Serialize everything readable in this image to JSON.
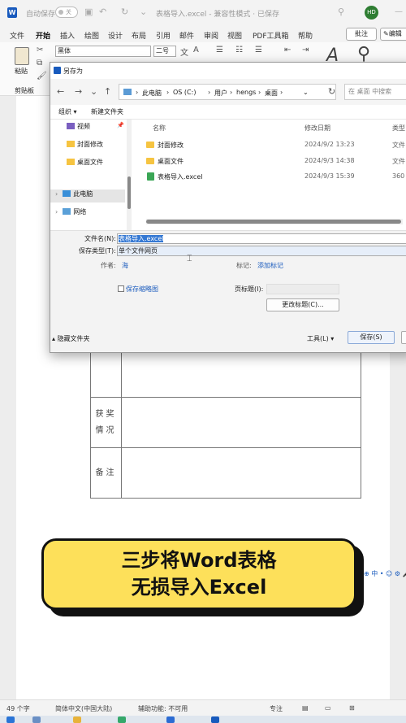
{
  "titlebar": {
    "autosave_label": "自动保存",
    "autosave_state": "关",
    "doc_title": "表格导入.excel  -  兼容性模式 · 已保存",
    "avatar_initials": "HD"
  },
  "ribbon": {
    "tabs": [
      "文件",
      "开始",
      "插入",
      "绘图",
      "设计",
      "布局",
      "引用",
      "邮件",
      "审阅",
      "视图",
      "PDF工具箱",
      "帮助"
    ],
    "active_tab": "开始",
    "comment_button": "批注",
    "edit_button": "编辑",
    "paste_label": "粘贴",
    "clipboard_label": "剪贴板",
    "font_name": "黑体",
    "font_size": "二号"
  },
  "dialog": {
    "title": "另存为",
    "breadcrumb": [
      "此电脑",
      "OS (C:)",
      "用户",
      "hengs",
      "桌面"
    ],
    "search_placeholder": "在 桌面 中搜索",
    "organize_label": "组织",
    "new_folder_label": "新建文件夹",
    "nav_items": [
      "视频",
      "封面修改",
      "桌面文件",
      "此电脑",
      "网络"
    ],
    "columns": [
      "名称",
      "修改日期",
      "类型"
    ],
    "files": [
      {
        "name": "封面修改",
        "date": "2024/9/2 13:23",
        "type": "文件",
        "kind": "folder"
      },
      {
        "name": "桌面文件",
        "date": "2024/9/3 14:38",
        "type": "文件",
        "kind": "folder"
      },
      {
        "name": "表格导入.excel",
        "date": "2024/9/3 15:39",
        "type": "360",
        "kind": "file"
      }
    ],
    "filename_label": "文件名(N):",
    "filename_value": "表格导入.excel",
    "filetype_label": "保存类型(T):",
    "filetype_value": "单个文件网页",
    "author_label": "作者:",
    "author_value": "海",
    "tags_label": "标记:",
    "tags_value": "添加标记",
    "thumbnail_label": "保存缩略图",
    "page_title_label": "页标题(I):",
    "change_title_button": "更改标题(C)...",
    "hide_folders_label": "隐藏文件夹",
    "tools_label": "工具(L)",
    "save_button": "保存(S)"
  },
  "document": {
    "row_awards": "获奖情况",
    "row_notes": "备注"
  },
  "banner": {
    "line1": "三步将Word表格",
    "line2": "无损导入Excel"
  },
  "statusbar": {
    "word_count": "49 个字",
    "language": "简体中文(中国大陆)",
    "accessibility": "辅助功能: 不可用",
    "focus": "专注"
  },
  "colors": {
    "accent": "#185abd",
    "banner_fill": "#fde05a",
    "selection": "#3478d3"
  }
}
